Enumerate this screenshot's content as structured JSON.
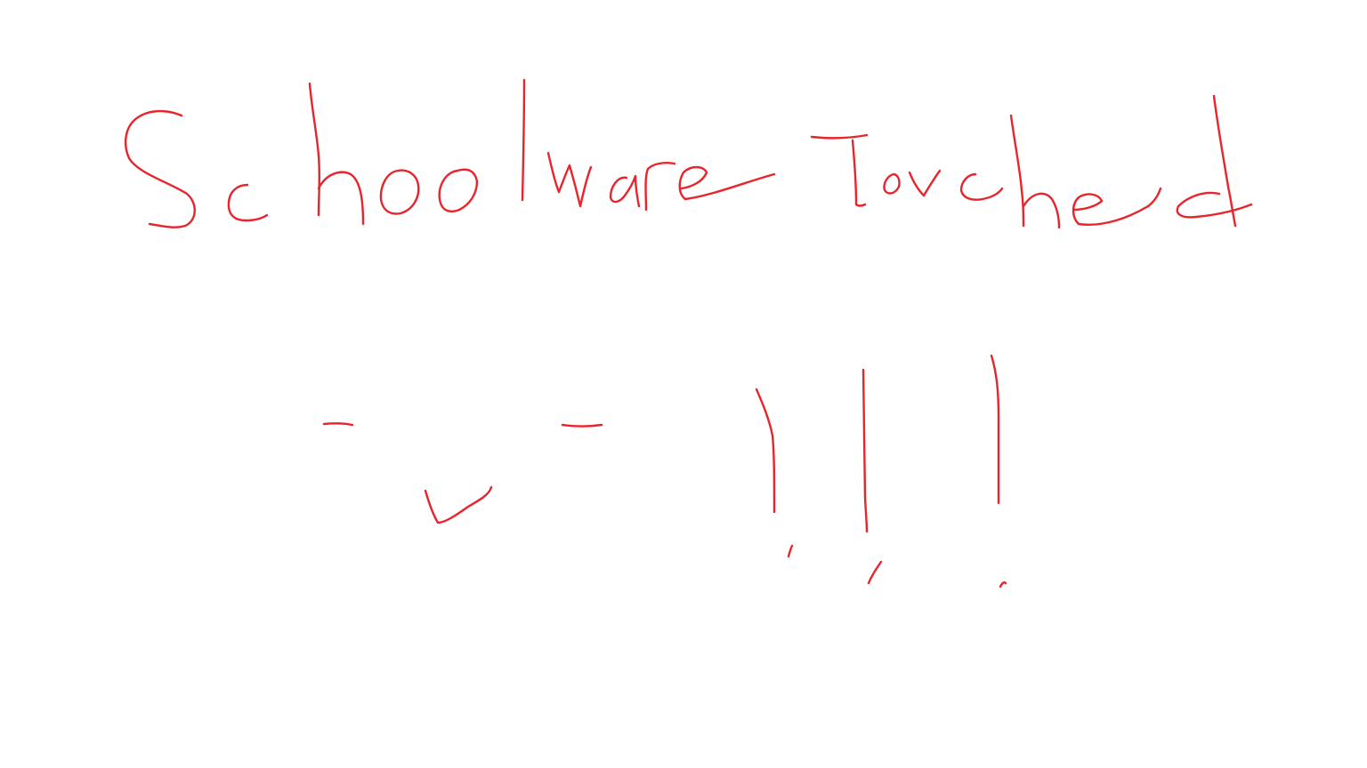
{
  "canvas": {
    "background": "#ffffff",
    "ink_color": "#e8242c"
  },
  "handwriting": {
    "line1": "Schoolware Touched",
    "face": "-_-",
    "tears": "!!!"
  }
}
